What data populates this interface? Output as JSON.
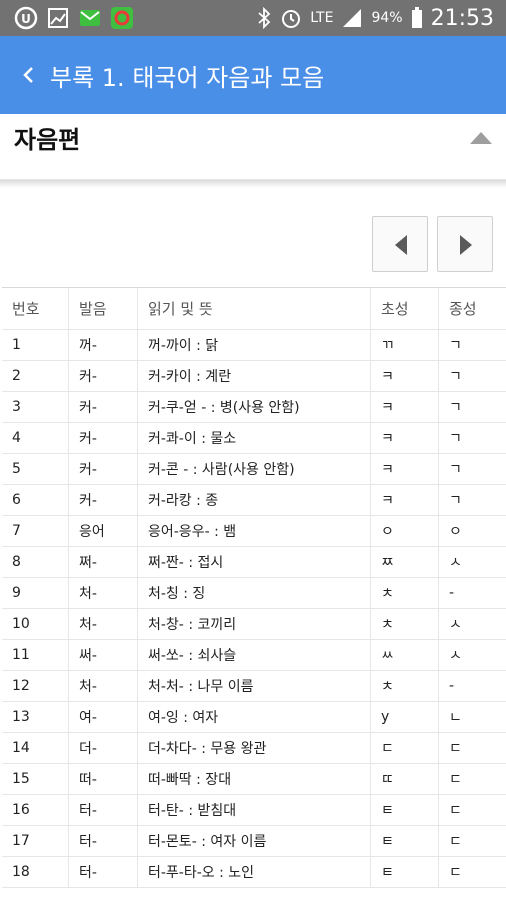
{
  "status_bar": {
    "icons": [
      "ucloud-icon",
      "gallery-icon",
      "message-icon",
      "circle-app-icon"
    ],
    "right_icons": [
      "bluetooth-icon",
      "alarm-icon",
      "lte-icon",
      "signal-icon",
      "battery-icon"
    ],
    "network": "LTE",
    "battery": "94%",
    "time": "21:53"
  },
  "app_bar": {
    "title": "부록 1. 태국어 자음과 모음",
    "color": "#4a8fe7"
  },
  "section": {
    "title": "자음편"
  },
  "table": {
    "headers": [
      "번호",
      "발음",
      "읽기 및 뜻",
      "초성",
      "종성"
    ],
    "rows": [
      [
        "1",
        "꺼-",
        "꺼-까이 : 닭",
        "ㄲ",
        "ㄱ"
      ],
      [
        "2",
        "커-",
        "커-카이 : 계란",
        "ㅋ",
        "ㄱ"
      ],
      [
        "3",
        "커-",
        "커-쿠-얻 - : 병(사용 안함)",
        "ㅋ",
        "ㄱ"
      ],
      [
        "4",
        "커-",
        "커-콰-이 : 물소",
        "ㅋ",
        "ㄱ"
      ],
      [
        "5",
        "커-",
        "커-콘 - : 사람(사용 안함)",
        "ㅋ",
        "ㄱ"
      ],
      [
        "6",
        "커-",
        "커-라캉 : 종",
        "ㅋ",
        "ㄱ"
      ],
      [
        "7",
        "응어",
        "응어-응우- : 뱀",
        "ㅇ",
        "ㅇ"
      ],
      [
        "8",
        "쩌-",
        "쩌-짠- : 접시",
        "ㅉ",
        "ㅅ"
      ],
      [
        "9",
        "처-",
        "처-칭 : 징",
        "ㅊ",
        "-"
      ],
      [
        "10",
        "처-",
        "처-창- : 코끼리",
        "ㅊ",
        "ㅅ"
      ],
      [
        "11",
        "써-",
        "써-쏘- : 쇠사슬",
        "ㅆ",
        "ㅅ"
      ],
      [
        "12",
        "처-",
        "처-처- : 나무 이름",
        "ㅊ",
        "-"
      ],
      [
        "13",
        "여-",
        "여-잉 : 여자",
        "y",
        "ㄴ"
      ],
      [
        "14",
        "더-",
        "더-차다- : 무용 왕관",
        "ㄷ",
        "ㄷ"
      ],
      [
        "15",
        "떠-",
        "떠-빠딱 : 장대",
        "ㄸ",
        "ㄷ"
      ],
      [
        "16",
        "터-",
        "터-탄- : 받침대",
        "ㅌ",
        "ㄷ"
      ],
      [
        "17",
        "터-",
        "터-몬토- : 여자 이름",
        "ㅌ",
        "ㄷ"
      ],
      [
        "18",
        "터-",
        "터-푸-타-오 : 노인",
        "ㅌ",
        "ㄷ"
      ]
    ]
  }
}
